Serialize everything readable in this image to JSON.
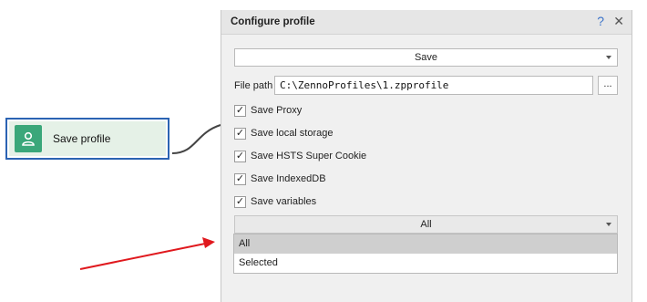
{
  "node": {
    "label": "Save profile",
    "icon": "user-icon",
    "icon_color": "#3aa77a",
    "border_color": "#2b63b3"
  },
  "dialog": {
    "title": "Configure profile",
    "help_glyph": "?",
    "close_glyph": "✕",
    "action_combo": {
      "value": "Save"
    },
    "file_path": {
      "label": "File path",
      "value": "C:\\ZennoProfiles\\1.zpprofile",
      "browse_label": "..."
    },
    "options": [
      {
        "label": "Save Proxy",
        "checked": true
      },
      {
        "label": "Save local storage",
        "checked": true
      },
      {
        "label": "Save HSTS Super Cookie",
        "checked": true
      },
      {
        "label": "Save IndexedDB",
        "checked": true
      },
      {
        "label": "Save variables",
        "checked": true
      }
    ],
    "variables_combo": {
      "value": "All",
      "options": [
        "All",
        "Selected"
      ],
      "highlighted": "All"
    }
  },
  "annotation": {
    "arrow_color": "#e0191e"
  }
}
